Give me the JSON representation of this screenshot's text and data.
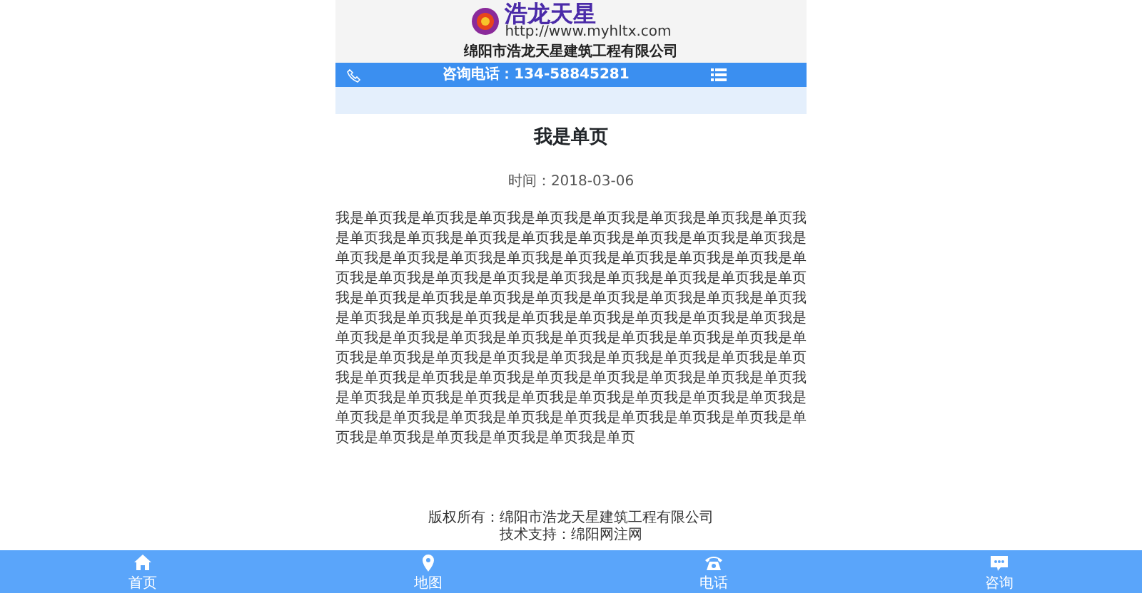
{
  "header": {
    "logo_text": "浩龙天星",
    "logo_url": "http://www.myhltx.com",
    "company": "绵阳市浩龙天星建筑工程有限公司"
  },
  "contact_bar": {
    "phone_label": "咨询电话：",
    "phone": "134-58845281"
  },
  "article": {
    "title": "我是单页",
    "date": "时间：2018-03-06",
    "body": "我是单页我是单页我是单页我是单页我是单页我是单页我是单页我是单页我是单页我是单页我是单页我是单页我是单页我是单页我是单页我是单页我是单页我是单页我是单页我是单页我是单页我是单页我是单页我是单页我是单页我是单页我是单页我是单页我是单页我是单页我是单页我是单页我是单页我是单页我是单页我是单页我是单页我是单页我是单页我是单页我是单页我是单页我是单页我是单页我是单页我是单页我是单页我是单页我是单页我是单页我是单页我是单页我是单页我是单页我是单页我是单页我是单页我是单页我是单页我是单页我是单页我是单页我是单页我是单页我是单页我是单页我是单页我是单页我是单页我是单页我是单页我是单页我是单页我是单页我是单页我是单页我是单页我是单页我是单页我是单页我是单页我是单页我是单页我是单页我是单页我是单页我是单页我是单页我是单页我是单页我是单页我是单页我是单页我是单页我是单页我是单页"
  },
  "footer": [
    "版权所有：绵阳市浩龙天星建筑工程有限公司",
    "技术支持：绵阳网注网"
  ],
  "bottom_nav": [
    {
      "kind": "home",
      "label": "首页"
    },
    {
      "kind": "map",
      "label": "地图"
    },
    {
      "kind": "phone",
      "label": "电话"
    },
    {
      "kind": "chat",
      "label": "咨询"
    }
  ]
}
